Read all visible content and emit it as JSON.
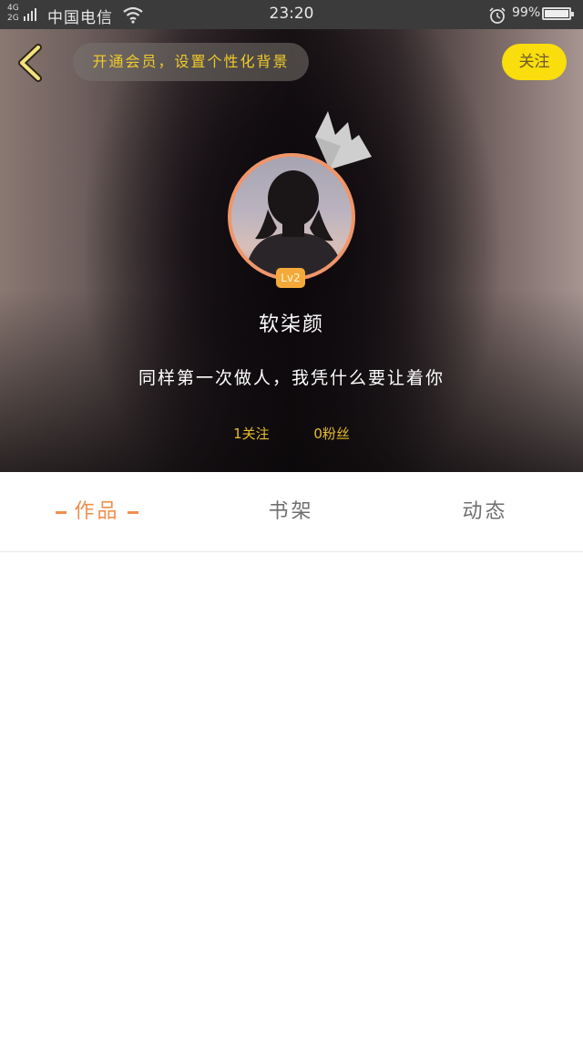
{
  "status_bar": {
    "network": "4G\n2G",
    "carrier": "中国电信",
    "time": "23:20",
    "battery_pct": "99%",
    "wifi_icon": "wifi-icon",
    "alarm_icon": "alarm-icon",
    "battery_icon": "battery-icon"
  },
  "header": {
    "vip_banner": "开通会员，设置个性化背景",
    "follow_label": "关注",
    "level": "Lv2",
    "username": "软柒颜",
    "bio": "同样第一次做人，我凭什么要让着你",
    "following": "1关注",
    "followers": "0粉丝",
    "back_icon": "chevron-left-icon",
    "crown_icon": "crown-icon"
  },
  "tabs": [
    {
      "label": "作品",
      "active": true
    },
    {
      "label": "书架",
      "active": false
    },
    {
      "label": "动态",
      "active": false
    }
  ],
  "colors": {
    "accent": "#ef8f4e",
    "follow_button": "#f9dd0c",
    "banner_text": "#f2cb2b",
    "stats_text": "#e8bd2c",
    "badge": "#f4a93a"
  }
}
